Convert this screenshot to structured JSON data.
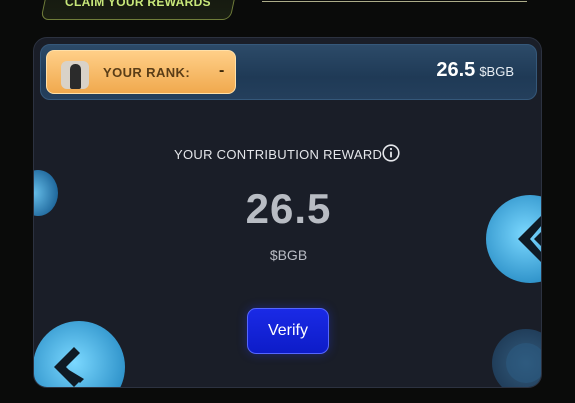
{
  "header": {
    "claim_label": "CLAIM YOUR REWARDS"
  },
  "rank": {
    "label": "YOUR RANK:",
    "value": "-",
    "amount": "26.5",
    "unit": "$BGB"
  },
  "contribution": {
    "title": "YOUR CONTRIBUTION REWARD",
    "value": "26.5",
    "unit": "$BGB"
  },
  "verify": {
    "label": "Verify"
  },
  "colors": {
    "accent_blue": "#1122dd",
    "rank_gold": "#f5b65e",
    "card_bg": "#1a1e28"
  }
}
